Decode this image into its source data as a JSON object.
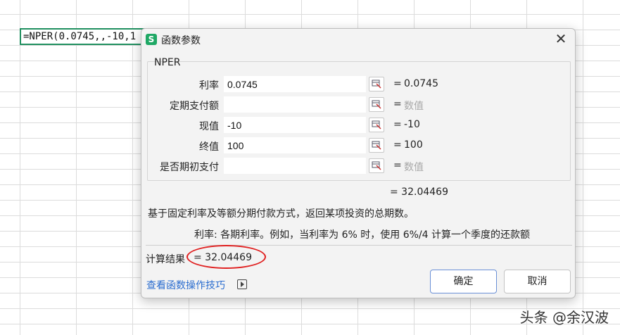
{
  "spreadsheet": {
    "formula_cell": "=NPER(0.0745,,-10,1"
  },
  "dialog": {
    "title": "函数参数",
    "close_glyph": "✕",
    "app_icon_letter": "S",
    "group_title": "NPER",
    "args": [
      {
        "label": "利率",
        "value": "0.0745",
        "eq": "=",
        "result": "0.0745",
        "placeholder": false
      },
      {
        "label": "定期支付额",
        "value": "",
        "eq": "=",
        "result": "数值",
        "placeholder": true
      },
      {
        "label": "现值",
        "value": "-10",
        "eq": "=",
        "result": "-10",
        "placeholder": false
      },
      {
        "label": "终值",
        "value": "100",
        "eq": "=",
        "result": "100",
        "placeholder": false
      },
      {
        "label": "是否期初支付",
        "value": "",
        "eq": "=",
        "result": "数值",
        "placeholder": true
      }
    ],
    "total_result": "= 32.04469",
    "description": "基于固定利率及等额分期付款方式，返回某项投资的总期数。",
    "arg_description": "利率:  各期利率。例如，当利率为 6% 时，使用 6%/4 计算一个季度的还款额",
    "calc_label": "计算结果",
    "calc_value": "= 32.04469",
    "help_link": "查看函数操作技巧",
    "ok_label": "确定",
    "cancel_label": "取消"
  },
  "watermark": "头条 @余汉波",
  "colors": {
    "accent_green": "#1fa865",
    "annotation_red": "#e02020",
    "link_blue": "#2a6ccf"
  }
}
